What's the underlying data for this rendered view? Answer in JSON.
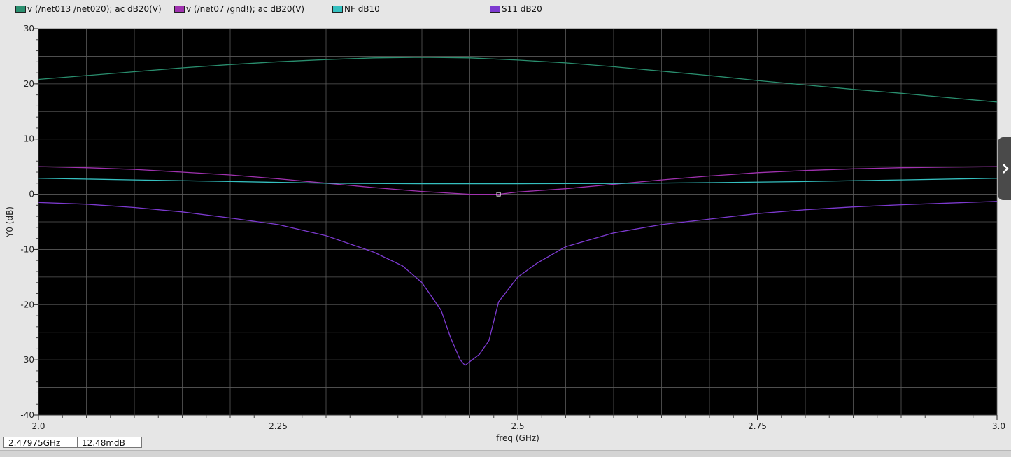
{
  "chart_data": {
    "type": "line",
    "xlabel": "freq (GHz)",
    "ylabel": "Y0 (dB)",
    "xlim": [
      2.0,
      3.0
    ],
    "ylim": [
      -40,
      30
    ],
    "x_ticks": [
      2.0,
      2.25,
      2.5,
      2.75,
      3.0
    ],
    "x_tick_labels": [
      "2.0",
      "2.25",
      "2.5",
      "2.75",
      "3.0"
    ],
    "y_ticks": [
      30,
      20,
      10,
      0,
      -10,
      -20,
      -30,
      -40
    ],
    "y_tick_labels": [
      "30",
      "20",
      "10",
      "0",
      "-10",
      "-20",
      "-30",
      "-40"
    ],
    "grid": true,
    "legend_position": "top",
    "background": "#000000",
    "series": [
      {
        "name": "v (/net013 /net020); ac dB20(V)",
        "color": "#2a8f6f",
        "x": [
          2.0,
          2.05,
          2.1,
          2.15,
          2.2,
          2.25,
          2.3,
          2.35,
          2.4,
          2.45,
          2.5,
          2.55,
          2.6,
          2.65,
          2.7,
          2.75,
          2.8,
          2.85,
          2.9,
          2.95,
          3.0
        ],
        "y": [
          20.8,
          21.5,
          22.2,
          22.9,
          23.5,
          24.0,
          24.4,
          24.7,
          24.8,
          24.7,
          24.3,
          23.8,
          23.1,
          22.3,
          21.5,
          20.6,
          19.8,
          19.0,
          18.3,
          17.5,
          16.7
        ]
      },
      {
        "name": "v (/net07 /gnd!); ac dB20(V)",
        "color": "#a032b0",
        "x": [
          2.0,
          2.05,
          2.1,
          2.15,
          2.2,
          2.25,
          2.3,
          2.35,
          2.4,
          2.45,
          2.48,
          2.5,
          2.55,
          2.6,
          2.65,
          2.7,
          2.75,
          2.8,
          2.85,
          2.9,
          2.95,
          3.0
        ],
        "y": [
          5.0,
          4.8,
          4.5,
          4.0,
          3.5,
          2.8,
          2.0,
          1.2,
          0.5,
          0.0,
          0.0,
          0.4,
          1.0,
          1.8,
          2.6,
          3.3,
          3.9,
          4.3,
          4.6,
          4.8,
          4.9,
          5.0
        ]
      },
      {
        "name": "NF dB10",
        "color": "#35c0c0",
        "x": [
          2.0,
          2.1,
          2.2,
          2.3,
          2.4,
          2.5,
          2.6,
          2.7,
          2.8,
          2.9,
          3.0
        ],
        "y": [
          2.9,
          2.6,
          2.3,
          2.0,
          1.9,
          1.9,
          1.95,
          2.1,
          2.3,
          2.6,
          2.9
        ]
      },
      {
        "name": "S11 dB20",
        "color": "#7d3ad0",
        "x": [
          2.0,
          2.05,
          2.1,
          2.15,
          2.2,
          2.25,
          2.3,
          2.35,
          2.38,
          2.4,
          2.42,
          2.43,
          2.44,
          2.445,
          2.46,
          2.47,
          2.48,
          2.5,
          2.52,
          2.55,
          2.6,
          2.65,
          2.7,
          2.75,
          2.8,
          2.85,
          2.9,
          2.95,
          3.0
        ],
        "y": [
          -1.5,
          -1.8,
          -2.4,
          -3.2,
          -4.3,
          -5.5,
          -7.5,
          -10.5,
          -13.0,
          -16.0,
          -21.0,
          -26.0,
          -30.0,
          -31.0,
          -29.0,
          -26.5,
          -19.5,
          -15.0,
          -12.5,
          -9.5,
          -7.0,
          -5.5,
          -4.5,
          -3.5,
          -2.8,
          -2.3,
          -1.9,
          -1.6,
          -1.3
        ]
      }
    ],
    "marker": {
      "x": 2.48,
      "y": 0.0
    }
  },
  "readout": {
    "x_value": "2.47975GHz",
    "y_value": "12.48mdB"
  }
}
